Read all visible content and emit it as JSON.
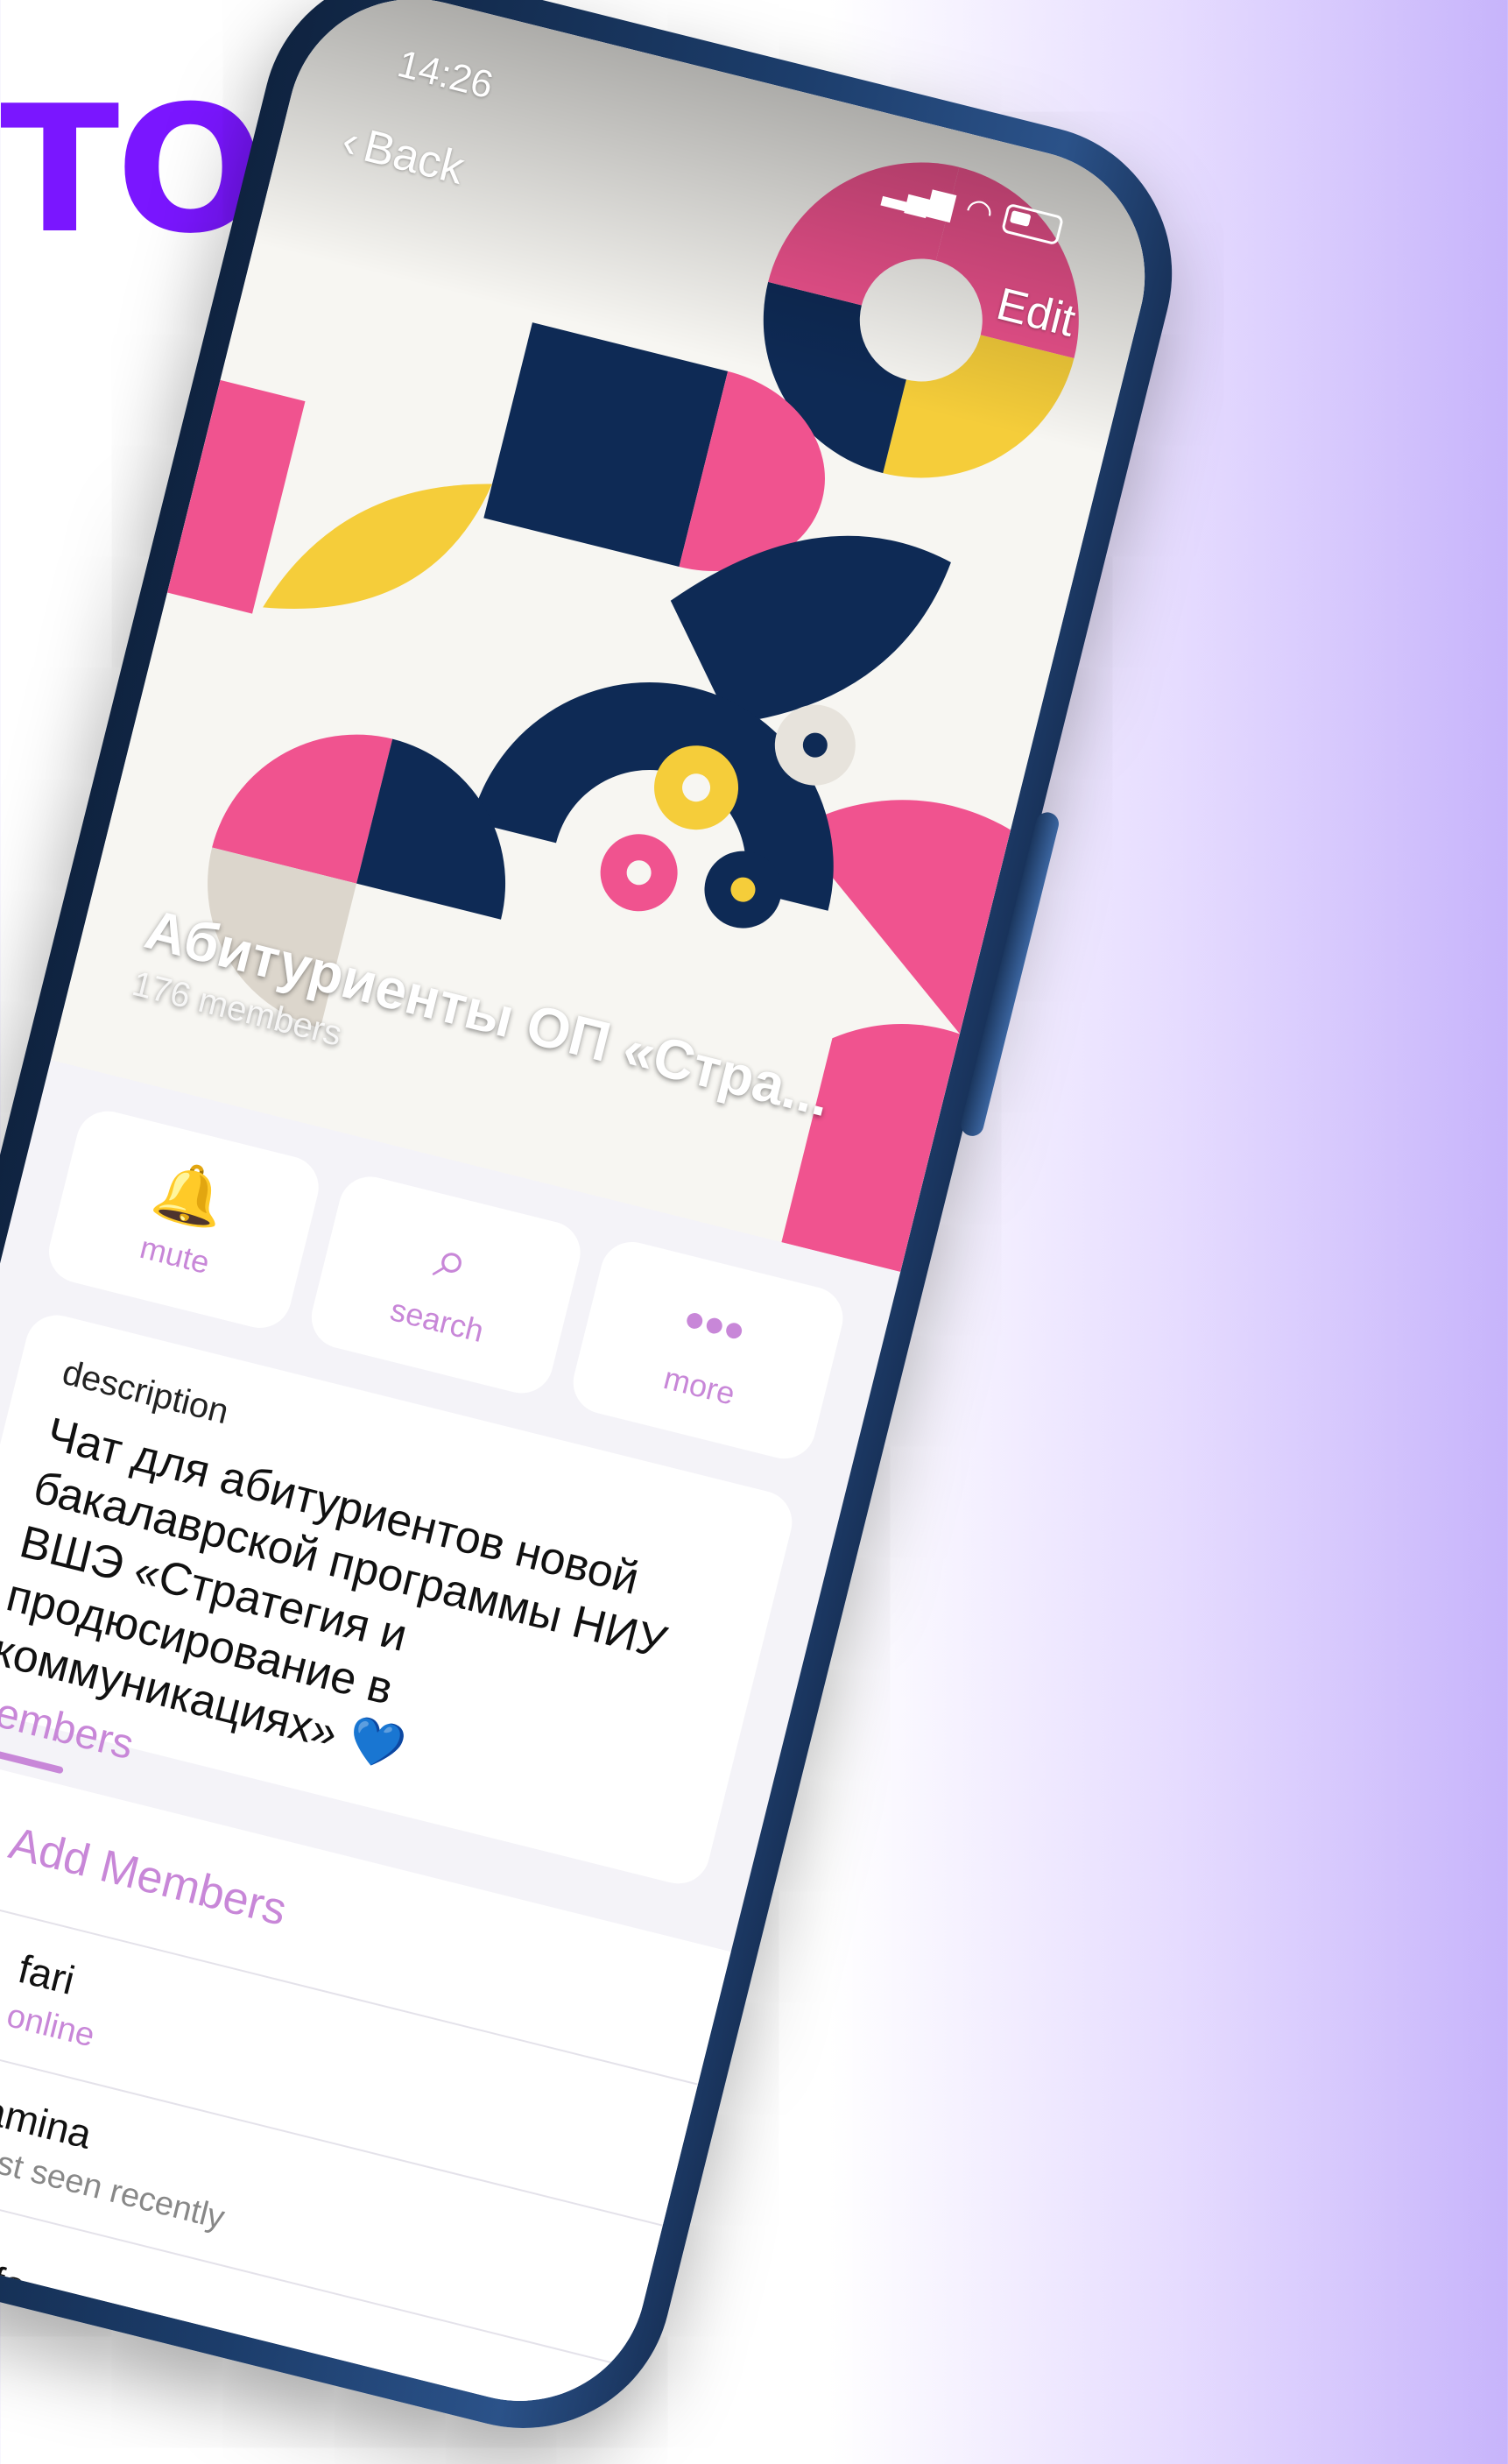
{
  "headline": "ТОВ",
  "colors": {
    "accent": "#c887d8",
    "headline": "#7a16ff",
    "frame": "#1c3d6b",
    "pink": "#f0538f",
    "navy": "#0e2a55",
    "yellow": "#f5cd3a"
  },
  "status_bar": {
    "time": "14:26"
  },
  "nav": {
    "back_label": "Back",
    "edit_label": "Edit"
  },
  "group": {
    "title": "Абитуриенты ОП «Стра...",
    "members_count": "176 members"
  },
  "actions": [
    {
      "label": "mute",
      "icon": "bell-icon"
    },
    {
      "label": "search",
      "icon": "search-icon"
    },
    {
      "label": "more",
      "icon": "more-icon"
    }
  ],
  "description": {
    "label": "description",
    "text": "Чат для абитуриентов новой бакалаврской программы НИУ ВШЭ «Стратегия и продюсирование в коммуникациях»"
  },
  "members_tab": {
    "label": "Members"
  },
  "add_members_label": "Add Members",
  "members": [
    {
      "name": "fari",
      "status": "online"
    },
    {
      "name": "amina",
      "status": "last seen recently"
    },
    {
      "name": "Sofa",
      "status": ""
    }
  ]
}
